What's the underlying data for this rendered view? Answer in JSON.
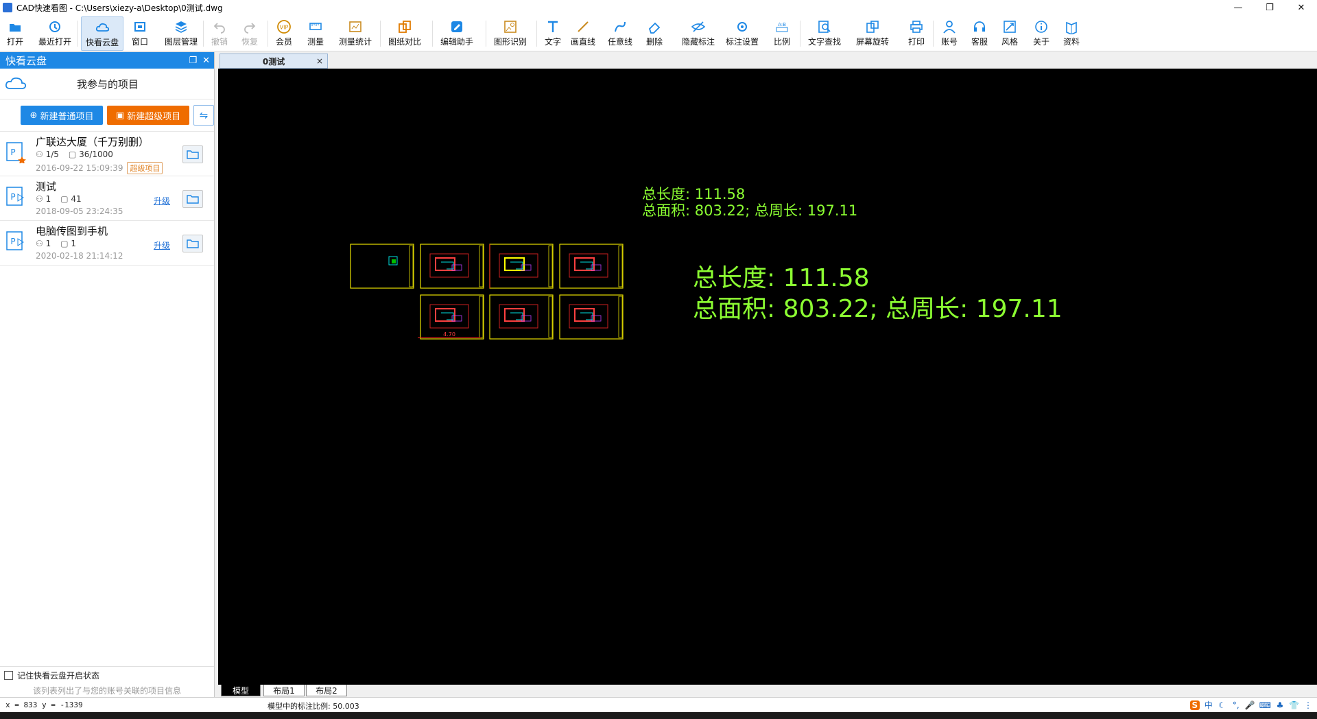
{
  "window": {
    "title": "CAD快速看图 - C:\\Users\\xiezy-a\\Desktop\\0测试.dwg",
    "min_glyph": "—",
    "restore_glyph": "❐",
    "close_glyph": "✕"
  },
  "toolbar": {
    "items": [
      {
        "label": "打开",
        "icon": "open-folder-icon",
        "enabled": true
      },
      {
        "label": "最近打开",
        "icon": "recent-clock-icon",
        "enabled": true
      },
      {
        "label": "快看云盘",
        "icon": "cloud-icon",
        "enabled": true,
        "active": true
      },
      {
        "label": "窗口",
        "icon": "window-icon",
        "enabled": true
      },
      {
        "label": "图层管理",
        "icon": "layers-icon",
        "enabled": true
      },
      {
        "label": "撤销",
        "icon": "undo-icon",
        "enabled": false
      },
      {
        "label": "恢复",
        "icon": "redo-icon",
        "enabled": false
      },
      {
        "label": "会员",
        "icon": "vip-icon",
        "enabled": true
      },
      {
        "label": "测量",
        "icon": "measure-icon",
        "enabled": true
      },
      {
        "label": "测量统计",
        "icon": "measure-stats-icon",
        "enabled": true
      },
      {
        "label": "图纸对比",
        "icon": "compare-icon",
        "enabled": true
      },
      {
        "label": "编辑助手",
        "icon": "edit-assistant-icon",
        "enabled": true
      },
      {
        "label": "图形识别",
        "icon": "shape-recognize-icon",
        "enabled": true
      },
      {
        "label": "文字",
        "icon": "text-icon",
        "enabled": true
      },
      {
        "label": "画直线",
        "icon": "line-icon",
        "enabled": true
      },
      {
        "label": "任意线",
        "icon": "freehand-icon",
        "enabled": true
      },
      {
        "label": "删除",
        "icon": "eraser-icon",
        "enabled": true
      },
      {
        "label": "隐藏标注",
        "icon": "hide-eye-icon",
        "enabled": true
      },
      {
        "label": "标注设置",
        "icon": "annotation-settings-icon",
        "enabled": true
      },
      {
        "label": "比例",
        "icon": "scale-icon",
        "enabled": true
      },
      {
        "label": "文字查找",
        "icon": "text-search-icon",
        "enabled": true
      },
      {
        "label": "屏幕旋转",
        "icon": "rotate-screen-icon",
        "enabled": true
      },
      {
        "label": "打印",
        "icon": "printer-icon",
        "enabled": true
      },
      {
        "label": "账号",
        "icon": "user-icon",
        "enabled": true
      },
      {
        "label": "客服",
        "icon": "headset-icon",
        "enabled": true
      },
      {
        "label": "风格",
        "icon": "style-icon",
        "enabled": true
      },
      {
        "label": "关于",
        "icon": "info-icon",
        "enabled": true
      },
      {
        "label": "资料",
        "icon": "resources-icon",
        "enabled": true
      }
    ]
  },
  "panel": {
    "title": "快看云盘",
    "section_title": "我参与的项目",
    "new_normal": "新建普通项目",
    "new_super": "新建超级项目",
    "projects": [
      {
        "name": "广联达大厦（千万别删）",
        "members": "1/5",
        "files": "36/1000",
        "date": "2016-09-22 15:09:39",
        "badge": "超级项目",
        "upgrade": ""
      },
      {
        "name": "测试",
        "members": "1",
        "files": "41",
        "date": "2018-09-05 23:24:35",
        "badge": "",
        "upgrade": "升级"
      },
      {
        "name": "电脑传图到手机",
        "members": "1",
        "files": "1",
        "date": "2020-02-18 21:14:12",
        "badge": "",
        "upgrade": "升级"
      }
    ],
    "remember_label": "记住快看云盘开启状态",
    "hint": "该列表列出了与您的账号关联的项目信息"
  },
  "doc_tab": {
    "label": "0测试",
    "close": "×"
  },
  "canvas": {
    "background": "#000000",
    "annotation_color": "#8cff32",
    "small_text": {
      "line1": "总长度: 111.58",
      "line2": "总面积: 803.22; 总周长: 197.11"
    },
    "large_text": {
      "line1": "总长度: 111.58",
      "line2": "总面积: 803.22; 总周长: 197.11"
    },
    "dim_label": "4.70"
  },
  "layout_tabs": [
    "模型",
    "布局1",
    "布局2"
  ],
  "status": {
    "coords": "x = 833  y = -1339",
    "scale": "模型中的标注比例: 50.003"
  },
  "tray": [
    "S",
    "中",
    "☾",
    "°,",
    "🎤",
    "⌨",
    "♣",
    "👕",
    "⋮"
  ]
}
